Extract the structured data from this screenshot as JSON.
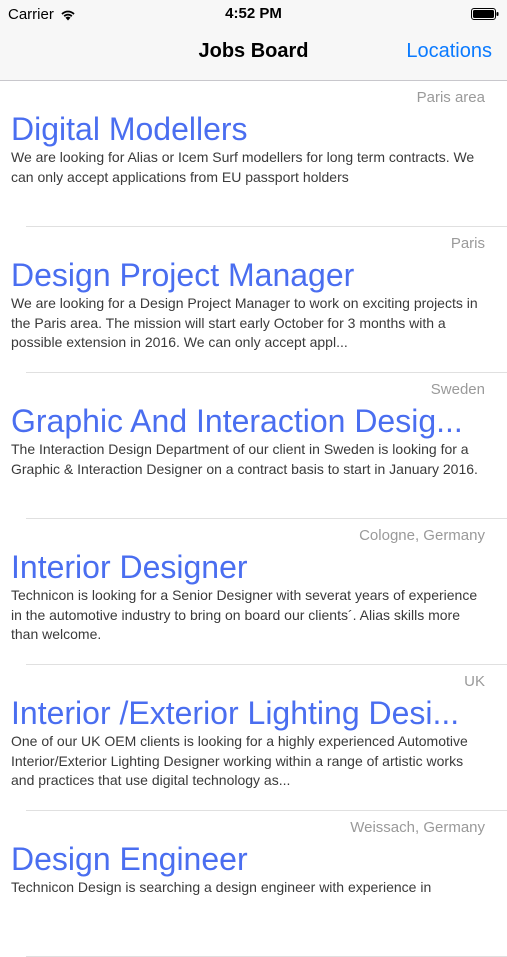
{
  "status_bar": {
    "carrier": "Carrier",
    "time": "4:52 PM",
    "wifi_icon": "wifi-icon",
    "battery_icon": "battery-icon"
  },
  "nav": {
    "title": "Jobs Board",
    "right_button": "Locations",
    "accent_color": "#0a7aff"
  },
  "jobs": [
    {
      "location": "Paris area",
      "title": "Digital Modellers",
      "description": "We are looking for Alias or Icem Surf modellers for long term contracts.  We can only accept applications from EU passport holders"
    },
    {
      "location": "Paris",
      "title": "Design Project Manager",
      "description": "We are looking for a Design Project Manager to work on exciting projects in the Paris area. The mission will start early October for 3 months with a possible extension in 2016. We can only accept appl..."
    },
    {
      "location": "Sweden",
      "title": "Graphic And Interaction Desig...",
      "description": "The Interaction Design Department of our client in Sweden  is looking for a Graphic & Interaction Designer on a contract basis to start in January 2016."
    },
    {
      "location": "Cologne, Germany",
      "title": "Interior Designer",
      "description": "Technicon is looking for a Senior Designer with severat years of experience in the automotive industry to bring on board our clients´. Alias skills more than welcome."
    },
    {
      "location": "UK",
      "title": "Interior /Exterior Lighting Desi...",
      "description": "One of our UK OEM clients is looking for a highly experienced Automotive Interior/Exterior Lighting Designer working within a range of artistic works and practices that use digital technology as..."
    },
    {
      "location": "Weissach, Germany",
      "title": "Design Engineer",
      "description": "Technicon Design is searching a design engineer with experience in"
    }
  ],
  "colors": {
    "title": "#4a6ef0",
    "location": "#9a9a9a",
    "description": "#3a3a3a"
  }
}
